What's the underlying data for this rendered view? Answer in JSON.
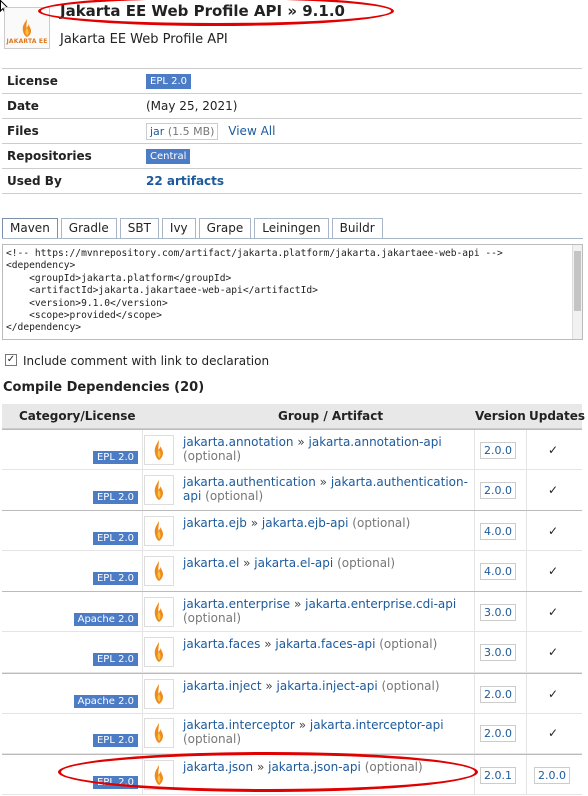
{
  "header": {
    "title": "Jakarta EE Web Profile API » 9.1.0",
    "subtitle": "Jakarta EE Web Profile API",
    "logo_text": "JAKARTA EE"
  },
  "info": {
    "license_label": "License",
    "license_value": "EPL 2.0",
    "date_label": "Date",
    "date_value": "(May 25, 2021)",
    "files_label": "Files",
    "files_jar": "jar",
    "files_size": "(1.5 MB)",
    "files_view_all": "View All",
    "repositories_label": "Repositories",
    "repositories_value": "Central",
    "usedby_label": "Used By",
    "usedby_value": "22 artifacts"
  },
  "tabs": [
    "Maven",
    "Gradle",
    "SBT",
    "Ivy",
    "Grape",
    "Leiningen",
    "Buildr"
  ],
  "code": "<!-- https://mvnrepository.com/artifact/jakarta.platform/jakarta.jakartaee-web-api -->\n<dependency>\n    <groupId>jakarta.platform</groupId>\n    <artifactId>jakarta.jakartaee-web-api</artifactId>\n    <version>9.1.0</version>\n    <scope>provided</scope>\n</dependency>",
  "include_comment": "Include comment with link to declaration",
  "deps_title": "Compile Dependencies (20)",
  "deps_headers": {
    "category": "Category/License",
    "artifact": "Group / Artifact",
    "version": "Version",
    "updates": "Updates"
  },
  "deps": [
    {
      "license": "EPL 2.0",
      "group": "jakarta.annotation",
      "artifact": "jakarta.annotation-api",
      "optional": "(optional)",
      "version": "2.0.0",
      "updates": "✓",
      "group_start": true
    },
    {
      "license": "EPL 2.0",
      "group": "jakarta.authentication",
      "artifact": "jakarta.authentication-api",
      "optional": "(optional)",
      "version": "2.0.0",
      "updates": "✓",
      "group_start": false
    },
    {
      "license": "EPL 2.0",
      "group": "jakarta.ejb",
      "artifact": "jakarta.ejb-api",
      "optional": "(optional)",
      "version": "4.0.0",
      "updates": "✓",
      "group_start": true
    },
    {
      "license": "EPL 2.0",
      "group": "jakarta.el",
      "artifact": "jakarta.el-api",
      "optional": "(optional)",
      "version": "4.0.0",
      "updates": "✓",
      "group_start": false
    },
    {
      "license": "Apache 2.0",
      "group": "jakarta.enterprise",
      "artifact": "jakarta.enterprise.cdi-api",
      "optional": "(optional)",
      "version": "3.0.0",
      "updates": "✓",
      "group_start": true
    },
    {
      "license": "EPL 2.0",
      "group": "jakarta.faces",
      "artifact": "jakarta.faces-api",
      "optional": "(optional)",
      "version": "3.0.0",
      "updates": "✓",
      "group_start": false
    },
    {
      "license": "Apache 2.0",
      "group": "jakarta.inject",
      "artifact": "jakarta.inject-api",
      "optional": "(optional)",
      "version": "2.0.0",
      "updates": "✓",
      "group_start": true
    },
    {
      "license": "EPL 2.0",
      "group": "jakarta.interceptor",
      "artifact": "jakarta.interceptor-api",
      "optional": "(optional)",
      "version": "2.0.0",
      "updates": "✓",
      "group_start": false
    },
    {
      "license": "EPL 2.0",
      "group": "jakarta.json",
      "artifact": "jakarta.json-api",
      "optional": "(optional)",
      "version": "2.0.1",
      "updates": "2.0.0",
      "group_start": true
    }
  ]
}
